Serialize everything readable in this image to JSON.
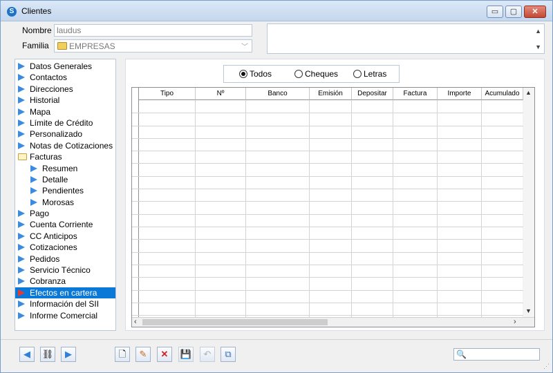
{
  "window": {
    "title": "Clientes",
    "minimize": "▭",
    "maximize": "▢",
    "close": "✕"
  },
  "form": {
    "nombre_label": "Nombre",
    "nombre_value": "laudus",
    "familia_label": "Familia",
    "familia_value": "EMPRESAS"
  },
  "tree": [
    {
      "label": "Datos Generales",
      "icon": "arrow",
      "level": 0
    },
    {
      "label": "Contactos",
      "icon": "arrow",
      "level": 0
    },
    {
      "label": "Direcciones",
      "icon": "arrow",
      "level": 0
    },
    {
      "label": "Historial",
      "icon": "arrow",
      "level": 0
    },
    {
      "label": "Mapa",
      "icon": "arrow",
      "level": 0
    },
    {
      "label": "Límite de Crédito",
      "icon": "arrow",
      "level": 0
    },
    {
      "label": "Personalizado",
      "icon": "arrow",
      "level": 0
    },
    {
      "label": "Notas de Cotizaciones",
      "icon": "arrow",
      "level": 0
    },
    {
      "label": "Facturas",
      "icon": "folder",
      "level": 0
    },
    {
      "label": "Resumen",
      "icon": "arrow",
      "level": 1
    },
    {
      "label": "Detalle",
      "icon": "arrow",
      "level": 1
    },
    {
      "label": "Pendientes",
      "icon": "arrow",
      "level": 1
    },
    {
      "label": "Morosas",
      "icon": "arrow",
      "level": 1
    },
    {
      "label": "Pago",
      "icon": "arrow",
      "level": 0
    },
    {
      "label": "Cuenta Corriente",
      "icon": "arrow",
      "level": 0
    },
    {
      "label": "CC Anticipos",
      "icon": "arrow",
      "level": 0
    },
    {
      "label": "Cotizaciones",
      "icon": "arrow",
      "level": 0
    },
    {
      "label": "Pedidos",
      "icon": "arrow",
      "level": 0
    },
    {
      "label": "Servicio Técnico",
      "icon": "arrow",
      "level": 0
    },
    {
      "label": "Cobranza",
      "icon": "arrow",
      "level": 0
    },
    {
      "label": "Efectos en cartera",
      "icon": "arrow",
      "level": 0,
      "selected": true
    },
    {
      "label": "Información del SII",
      "icon": "arrow",
      "level": 0
    },
    {
      "label": "Informe Comercial",
      "icon": "arrow",
      "level": 0
    }
  ],
  "filter": {
    "todos": "Todos",
    "cheques": "Cheques",
    "letras": "Letras",
    "selected": "todos"
  },
  "grid": {
    "columns": [
      "Tipo",
      "Nº",
      "Banco",
      "Emisión",
      "Depositar",
      "Factura",
      "Importe",
      "Acumulado"
    ]
  },
  "colors": {
    "selection": "#0a78d7",
    "tree_arrow": "#3c8be0",
    "selected_arrow": "#e33a35"
  },
  "toolbar": {
    "prev": "◀",
    "find": "⛓",
    "next": "▶",
    "new": "🗋",
    "edit": "✎",
    "delete": "✕",
    "save": "💾",
    "undo": "↶",
    "copy": "⧉",
    "search_icon": "🔍"
  }
}
